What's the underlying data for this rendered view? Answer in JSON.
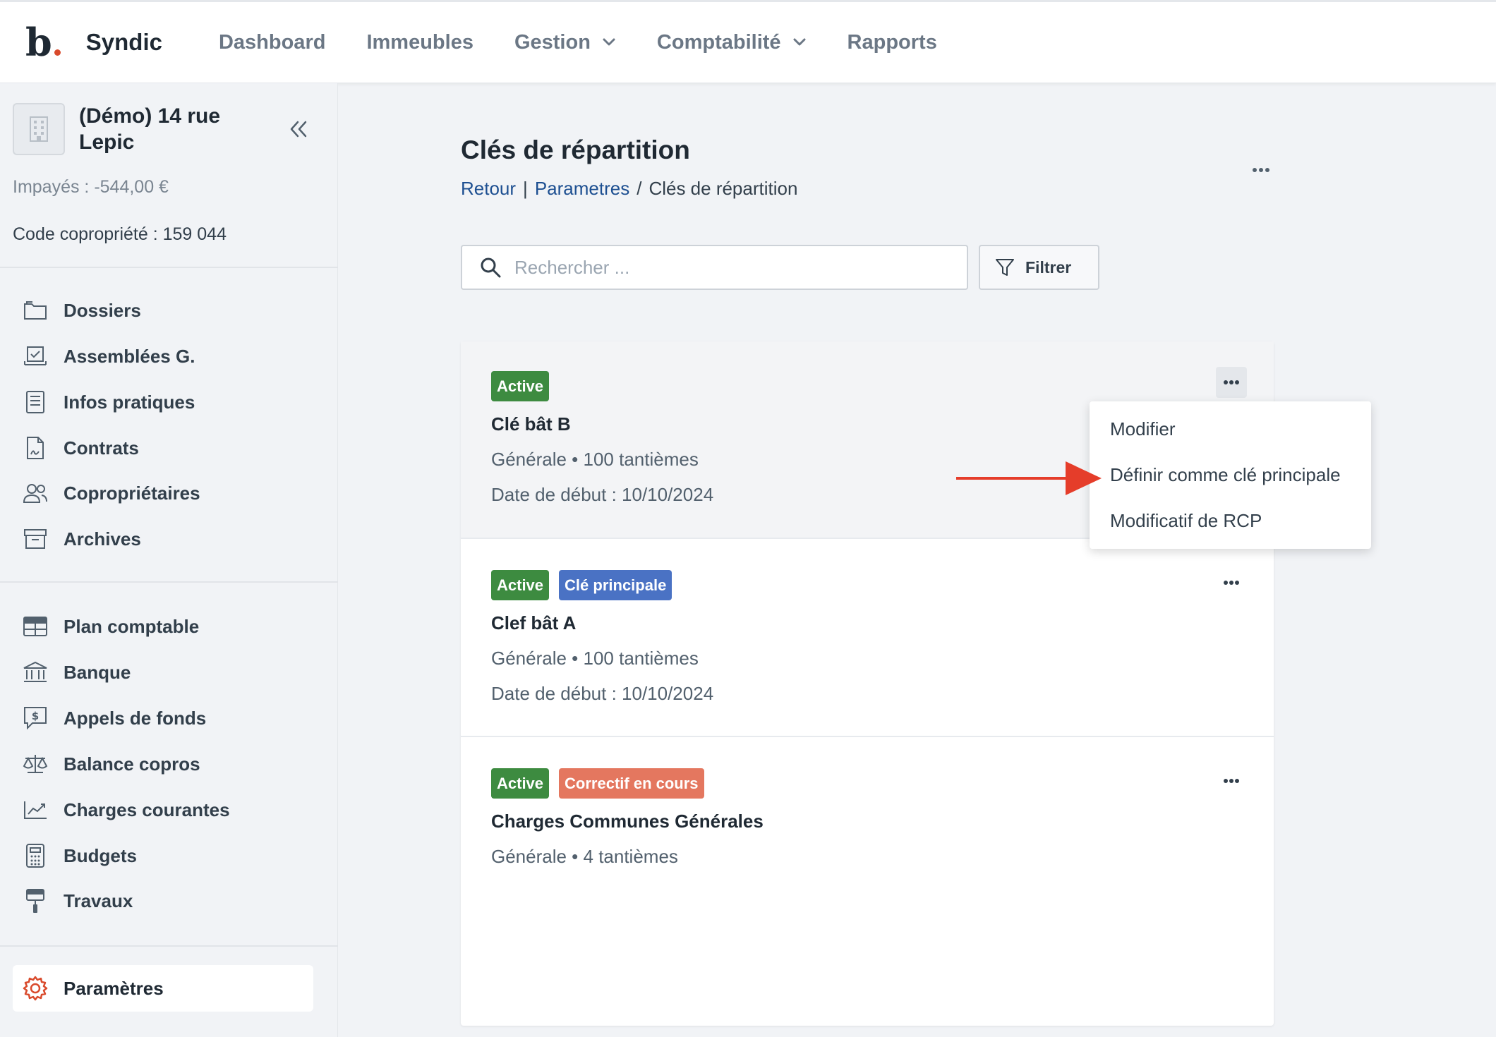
{
  "app": {
    "logo_letter": "b",
    "brand": "Syndic"
  },
  "nav": {
    "dashboard": "Dashboard",
    "immeubles": "Immeubles",
    "gestion": "Gestion",
    "comptabilite": "Comptabilité",
    "rapports": "Rapports"
  },
  "sidebar": {
    "building_name": "(Démo) 14 rue Lepic",
    "unpaid": "Impayés : -544,00 €",
    "code": "Code copropriété : 159 044",
    "items": [
      {
        "label": "Dossiers",
        "icon": "folder-icon"
      },
      {
        "label": "Assemblées G.",
        "icon": "laptop-check-icon"
      },
      {
        "label": "Infos pratiques",
        "icon": "book-icon"
      },
      {
        "label": "Contrats",
        "icon": "contract-icon"
      },
      {
        "label": "Copropriétaires",
        "icon": "users-icon"
      },
      {
        "label": "Archives",
        "icon": "archive-icon"
      },
      {
        "label": "Plan comptable",
        "icon": "table-icon"
      },
      {
        "label": "Banque",
        "icon": "bank-icon"
      },
      {
        "label": "Appels de fonds",
        "icon": "dollar-chat-icon"
      },
      {
        "label": "Balance copros",
        "icon": "scale-icon"
      },
      {
        "label": "Charges courantes",
        "icon": "chart-line-icon"
      },
      {
        "label": "Budgets",
        "icon": "calculator-icon"
      },
      {
        "label": "Travaux",
        "icon": "paint-roller-icon"
      }
    ],
    "settings": "Paramètres"
  },
  "page": {
    "title": "Clés de répartition",
    "breadcrumb": {
      "back": "Retour",
      "sep1": "|",
      "params": "Parametres",
      "sep2": "/",
      "current": "Clés de répartition"
    },
    "search_placeholder": "Rechercher ...",
    "filter_label": "Filtrer"
  },
  "cards": [
    {
      "badges": [
        "Active"
      ],
      "title": "Clé bât B",
      "line1": "Générale • 100 tantièmes",
      "line2": "Date de début : 10/10/2024"
    },
    {
      "badges": [
        "Active",
        "Clé principale"
      ],
      "title": "Clef bât A",
      "line1": "Générale • 100 tantièmes",
      "line2": "Date de début : 10/10/2024"
    },
    {
      "badges": [
        "Active",
        "Correctif en cours"
      ],
      "title": "Charges Communes Générales",
      "line1": "Générale • 4 tantièmes",
      "line2": ""
    }
  ],
  "dropdown": {
    "items": [
      "Modifier",
      "Définir comme clé principale",
      "Modificatif de RCP"
    ]
  },
  "colors": {
    "badge_active": "#3d8b40",
    "badge_primary": "#4a72c4",
    "badge_correctif": "#e4775f",
    "arrow": "#e53d2a",
    "logo_dot": "#d94a2c"
  }
}
